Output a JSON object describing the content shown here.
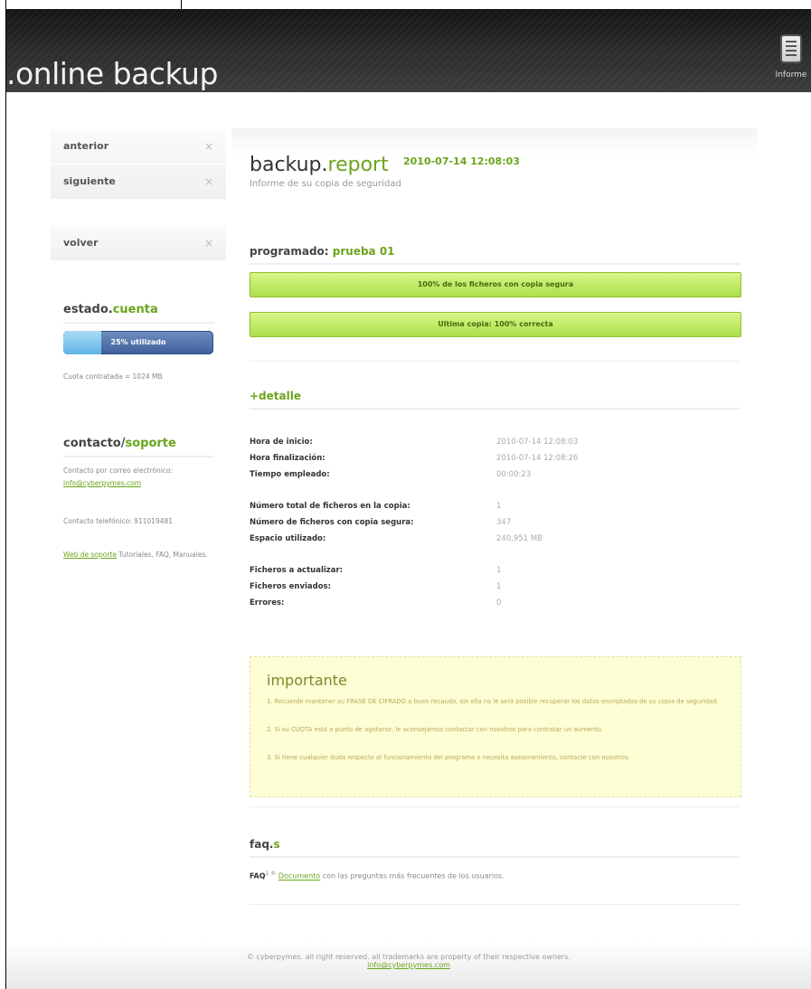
{
  "header": {
    "brand": ".online backup",
    "report_button": "Informe"
  },
  "sidebar": {
    "nav1": [
      {
        "label": "anterior",
        "x": "×"
      },
      {
        "label": "siguiente",
        "x": "×"
      }
    ],
    "nav2": [
      {
        "label": "volver",
        "x": "×"
      }
    ],
    "account": {
      "title_prefix": "estado.",
      "title_accent": "cuenta",
      "usage_text": "25% utilizado",
      "usage_fraction": 0.25,
      "quota_text": "Cuota contratada = 1024 MB"
    },
    "contact": {
      "title_prefix": "contacto/",
      "title_accent": "soporte",
      "email_label": "Contacto por correo electrónico:",
      "email": "info@cyberpymes.com",
      "phone": "Contacto telefónico: 911019481",
      "web_link": "Web de soporte",
      "web_rest": "Tutoriales, FAQ, Manuales."
    }
  },
  "main": {
    "title_prefix": "backup.",
    "title_accent": "report",
    "title_date": "2010-07-14 12:08:03",
    "subtitle": "Informe de su copia de seguridad",
    "scheduled_label": "programado:",
    "scheduled_name": "prueba 01",
    "bar1": "100% de los ficheros con copia segura",
    "bar2": "Ultima copia: 100% correcta",
    "detail_heading": "+detalle",
    "details": [
      {
        "label": "Hora de inicio:",
        "value": "2010-07-14 12:08:03"
      },
      {
        "label": "Hora finalización:",
        "value": "2010-07-14 12:08:26"
      },
      {
        "label": "Tiempo empleado:",
        "value": "00:00:23"
      },
      {
        "label": "Número total de ficheros en la copia:",
        "value": "1"
      },
      {
        "label": "Número de ficheros con copia segura:",
        "value": "347"
      },
      {
        "label": "Espacio utilizado:",
        "value": "240,951 MB"
      },
      {
        "label": "Ficheros a actualizar:",
        "value": "1"
      },
      {
        "label": "Ficheros enviados:",
        "value": "1"
      },
      {
        "label": "Errores:",
        "value": "0"
      }
    ],
    "important": {
      "title": "importante",
      "p1": "1. Recuerde mantener su FRASE DE CIFRADO a buen recaudo, sin ella no le será posible recuperar los datos encriptados de su copia de seguridad.",
      "p2": "2. Si su CUOTA está a punto de agotarse, le aconsejamos contactar con nosotros para contratar un aumento.",
      "p3": "3. Si tiene cualquier duda respecto al funcionamiento del programa o necesita asesoramiento, contacte con nosotros."
    },
    "faq": {
      "title_prefix": "faq.",
      "title_accent": "s",
      "lead": "FAQ",
      "lead_sup": "1 ®",
      "link": "Documento",
      "rest": "con las preguntas más frecuentes de los usuarios."
    }
  },
  "footer": {
    "line1": "© cyberpymes. all right reserved. all trademarks are property of their respective owners.",
    "email": "info@cyberpymes.com"
  }
}
